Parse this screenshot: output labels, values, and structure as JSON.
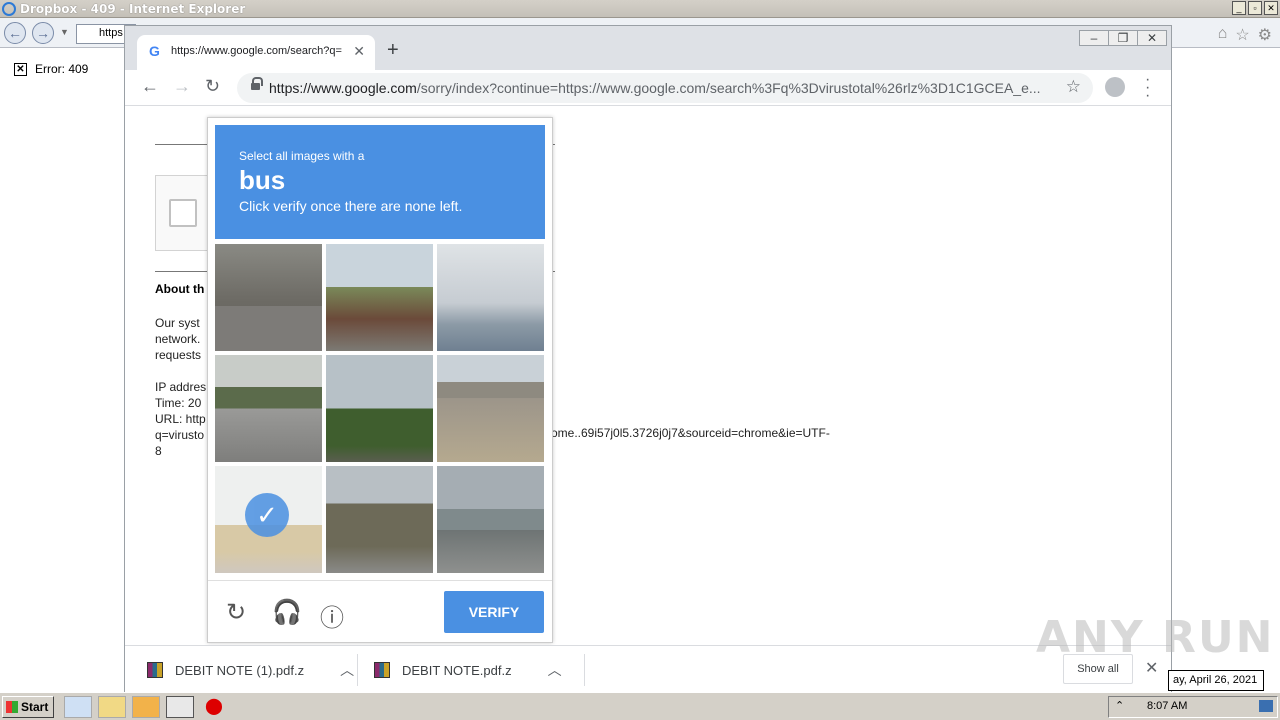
{
  "ie": {
    "title": "Dropbox - 409 - Internet Explorer",
    "address_text": "https",
    "error_text": "Error: 409"
  },
  "chrome": {
    "tab_title": "https://www.google.com/search?q=",
    "url_host": "https://www.google.com",
    "url_path": "/sorry/index?continue=https://www.google.com/search%3Fq%3Dvirustotal%26rlz%3D1C1GCEA_e..."
  },
  "page": {
    "about_heading": "About th",
    "para_lines": [
      "Our syst",
      "network.",
      "requests"
    ],
    "ip_line": "IP addres",
    "time_line": "Time: 20",
    "url_line": "URL: http",
    "q_line": "q=virusto",
    "eight_line": "8",
    "url_tail": "ome..69i57j0l5.3726j0j7&sourceid=chrome&ie=UTF-"
  },
  "captcha": {
    "prompt_small": "Select all images with a",
    "keyword": "bus",
    "instruction": "Click verify once there are none left.",
    "verify_label": "VERIFY",
    "accent_color": "#4a90e2",
    "tiles": [
      {
        "selected": false
      },
      {
        "selected": false
      },
      {
        "selected": false
      },
      {
        "selected": false
      },
      {
        "selected": false
      },
      {
        "selected": false
      },
      {
        "selected": true
      },
      {
        "selected": false
      },
      {
        "selected": false
      }
    ]
  },
  "downloads": {
    "items": [
      {
        "name": "DEBIT NOTE (1).pdf.z"
      },
      {
        "name": "DEBIT NOTE.pdf.z"
      }
    ],
    "show_all": "Show all"
  },
  "taskbar": {
    "start_label": "Start",
    "clock": "8:07 AM",
    "date_tooltip": "ay, April 26, 2021"
  },
  "watermark": "ANY RUN"
}
